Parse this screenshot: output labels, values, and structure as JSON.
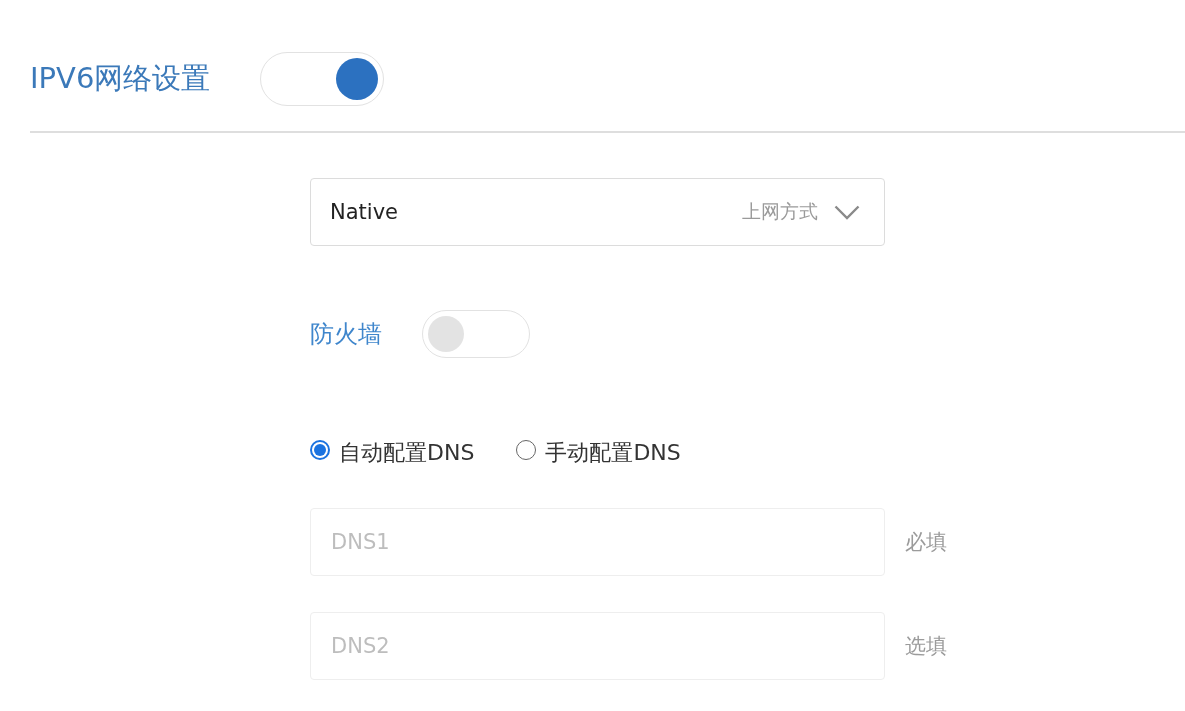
{
  "header": {
    "title": "IPV6网络设置",
    "toggle": {
      "on": true
    }
  },
  "connection_type": {
    "value": "Native",
    "label": "上网方式"
  },
  "firewall": {
    "label": "防火墙",
    "toggle": {
      "on": false
    }
  },
  "dns_mode": [
    {
      "label": "自动配置DNS",
      "selected": true
    },
    {
      "label": "手动配置DNS",
      "selected": false
    }
  ],
  "dns_fields": [
    {
      "placeholder": "DNS1",
      "hint": "必填",
      "disabled": true
    },
    {
      "placeholder": "DNS2",
      "hint": "选填",
      "disabled": true
    }
  ]
}
